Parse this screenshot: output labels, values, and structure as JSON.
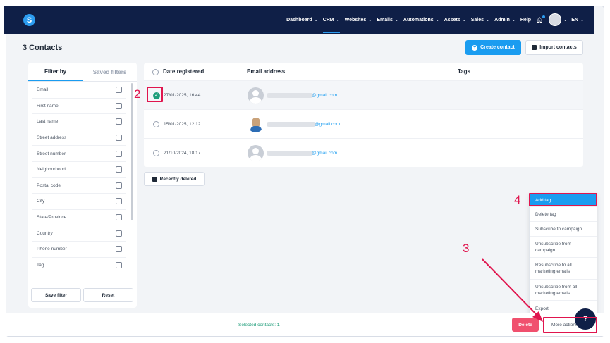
{
  "nav": {
    "logo": "S",
    "items": [
      {
        "label": "Dashboard",
        "chevron": true
      },
      {
        "label": "CRM",
        "chevron": true,
        "active": true
      },
      {
        "label": "Websites",
        "chevron": true
      },
      {
        "label": "Emails",
        "chevron": true
      },
      {
        "label": "Automations",
        "chevron": true
      },
      {
        "label": "Assets",
        "chevron": true
      },
      {
        "label": "Sales",
        "chevron": true
      },
      {
        "label": "Admin",
        "chevron": true
      },
      {
        "label": "Help",
        "chevron": false
      }
    ],
    "language": "EN"
  },
  "page": {
    "title": "3 Contacts",
    "create_button": "Create contact",
    "import_button": "Import contacts"
  },
  "filter": {
    "tab_filter": "Filter by",
    "tab_saved": "Saved filters",
    "fields": [
      "Email",
      "First name",
      "Last name",
      "Street address",
      "Street number",
      "Neighborhood",
      "Postal code",
      "City",
      "State/Province",
      "Country",
      "Phone number",
      "Tag"
    ],
    "save_button": "Save filter",
    "reset_button": "Reset"
  },
  "table": {
    "col_date": "Date registered",
    "col_email": "Email address",
    "col_tags": "Tags",
    "rows": [
      {
        "date": "27/01/2025, 16:44",
        "email": "@gmail.com",
        "selected": true
      },
      {
        "date": "15/01/2025, 12:12",
        "email": "@gmail.com",
        "selected": false
      },
      {
        "date": "21/10/2024, 18:17",
        "email": "@gmail.com",
        "selected": false
      }
    ]
  },
  "recently_deleted": "Recently deleted",
  "menu": {
    "items": [
      "Add tag",
      "Delete tag",
      "Subscribe to campaign",
      "Unsubscribe from campaign",
      "Resubscribe to all marketing emails",
      "Unsubscribe from all marketing emails",
      "Export"
    ]
  },
  "bottom": {
    "selected_label": "Selected contacts:",
    "selected_count": "1",
    "delete_button": "Delete",
    "more_button": "More actions"
  },
  "annotations": {
    "step2": "2",
    "step3": "3",
    "step4": "4",
    "color": "#e0154e"
  }
}
